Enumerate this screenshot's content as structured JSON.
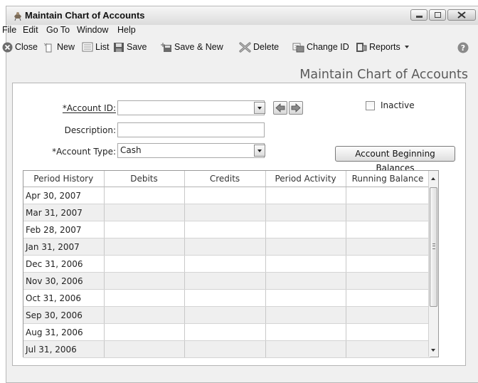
{
  "window": {
    "title": "Maintain Chart of Accounts"
  },
  "menu": [
    "File",
    "Edit",
    "Go To",
    "Window",
    "Help"
  ],
  "toolbar": {
    "close": "Close",
    "new": "New",
    "list": "List",
    "save": "Save",
    "save_new": "Save & New",
    "delete": "Delete",
    "change_id": "Change ID",
    "reports": "Reports"
  },
  "heading": "Maintain Chart of Accounts",
  "form": {
    "account_id_label": "*Account ID:",
    "account_id_value": "",
    "description_label": "Description:",
    "description_value": "",
    "account_type_label": "*Account Type:",
    "account_type_value": "Cash",
    "inactive_label": "Inactive",
    "inactive_checked": false,
    "beginning_balances_button": "Account Beginning Balances"
  },
  "grid": {
    "columns": [
      "Period History",
      "Debits",
      "Credits",
      "Period Activity",
      "Running Balance"
    ],
    "rows": [
      [
        "Apr 30, 2007",
        "",
        "",
        "",
        ""
      ],
      [
        "Mar 31, 2007",
        "",
        "",
        "",
        ""
      ],
      [
        "Feb 28, 2007",
        "",
        "",
        "",
        ""
      ],
      [
        "Jan 31, 2007",
        "",
        "",
        "",
        ""
      ],
      [
        "Dec 31, 2006",
        "",
        "",
        "",
        ""
      ],
      [
        "Nov 30, 2006",
        "",
        "",
        "",
        ""
      ],
      [
        "Oct 31, 2006",
        "",
        "",
        "",
        ""
      ],
      [
        "Sep 30, 2006",
        "",
        "",
        "",
        ""
      ],
      [
        "Aug 31, 2006",
        "",
        "",
        "",
        ""
      ],
      [
        "Jul 31, 2006",
        "",
        "",
        "",
        ""
      ]
    ]
  }
}
